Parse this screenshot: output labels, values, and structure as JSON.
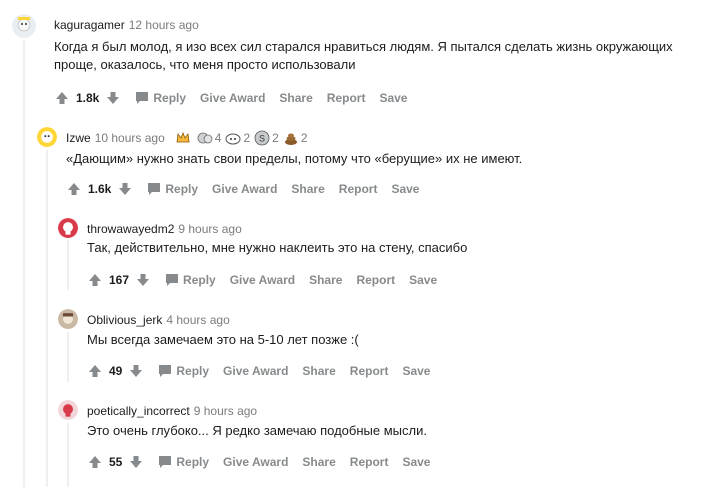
{
  "comments": [
    {
      "author": "kaguragamer",
      "time": "12 hours ago",
      "text_lines": [
        "Когда я был молод, я изо всех сил старался нравиться людям. Я пытался сделать жизнь окружающих",
        "проще, оказалось, что меня просто использовали"
      ],
      "score": "1.8k"
    },
    {
      "author": "Izwe",
      "time": "10 hours ago",
      "award_counts": [
        "4",
        "2",
        "2"
      ],
      "text_lines": [
        "«Дающим» нужно знать свои пределы, потому что «берущие» их не имеют."
      ],
      "score": "1.6k"
    },
    {
      "author": "throwawayedm2",
      "time": "9 hours ago",
      "text_lines": [
        "Так, действительно, мне нужно наклеить это на стену, спасибо"
      ],
      "score": "167"
    },
    {
      "author": "Oblivious_jerk",
      "time": "4 hours ago",
      "text_lines": [
        "Мы всегда замечаем это на 5-10 лет позже :("
      ],
      "score": "49"
    },
    {
      "author": "poetically_incorrect",
      "time": "9 hours ago",
      "text_lines": [
        "Это очень глубоко... Я редко замечаю подобные мысли."
      ],
      "score": "55"
    }
  ],
  "actions": {
    "reply": "Reply",
    "give_award": "Give Award",
    "share": "Share",
    "report": "Report",
    "save": "Save"
  },
  "colors": {
    "action_gray": "#878a8c",
    "thread_line": "#edeff1",
    "avatar_red": "#d93a4a"
  }
}
